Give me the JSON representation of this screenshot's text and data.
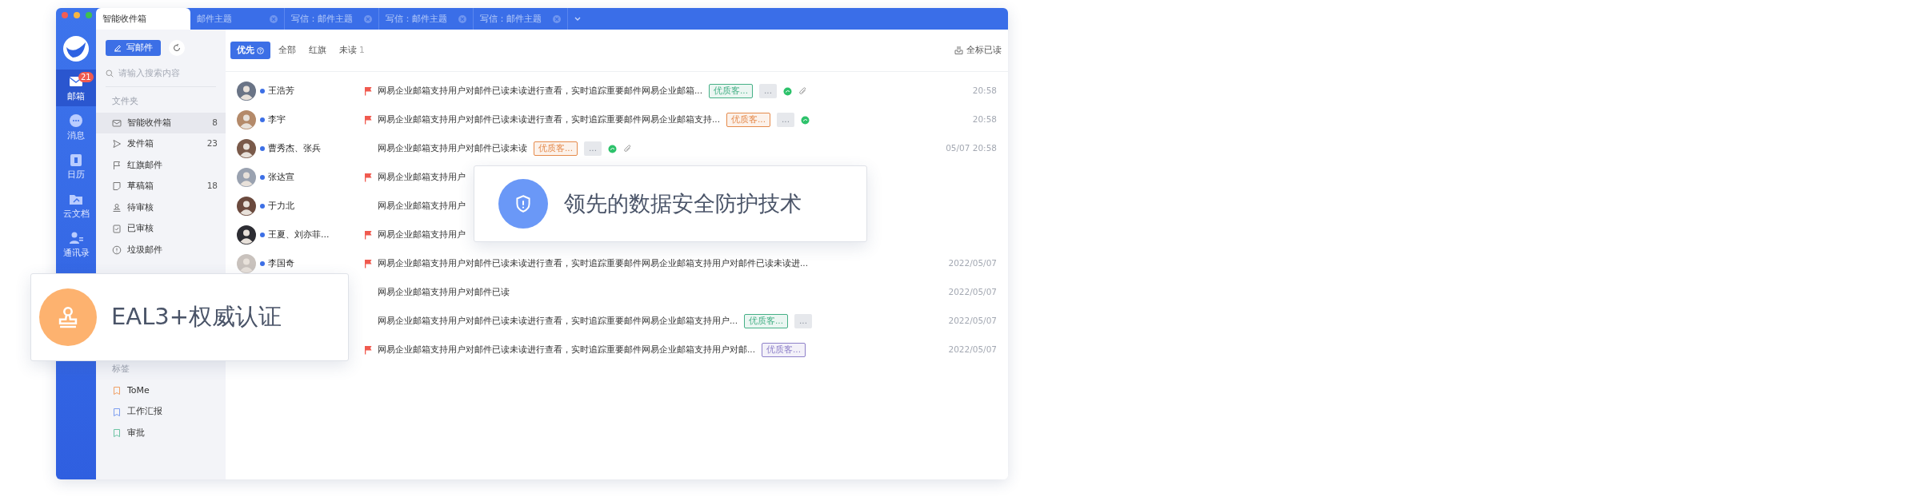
{
  "tabs": [
    {
      "label": "智能收件箱",
      "selected": true,
      "closable": false
    },
    {
      "label": "邮件主题",
      "selected": false,
      "closable": true
    },
    {
      "label": "写信：邮件主题",
      "selected": false,
      "closable": true
    },
    {
      "label": "写信：邮件主题",
      "selected": false,
      "closable": true
    },
    {
      "label": "写信：邮件主题",
      "selected": false,
      "closable": true
    }
  ],
  "rail": [
    {
      "label": "邮箱",
      "selected": true,
      "badge": "21"
    },
    {
      "label": "消息",
      "selected": false
    },
    {
      "label": "日历",
      "selected": false
    },
    {
      "label": "云文档",
      "selected": false
    },
    {
      "label": "通讯录",
      "selected": false
    }
  ],
  "compose_button": "写邮件",
  "search": {
    "placeholder": "请输入搜索内容"
  },
  "folders": {
    "title": "文件夹",
    "items": [
      {
        "label": "智能收件箱",
        "count": "8",
        "selected": true
      },
      {
        "label": "发件箱",
        "count": "23",
        "selected": false
      },
      {
        "label": "红旗邮件",
        "selected": false
      },
      {
        "label": "草稿箱",
        "count": "18",
        "selected": false
      },
      {
        "label": "待审核",
        "selected": false
      },
      {
        "label": "已审核",
        "selected": false
      },
      {
        "label": "垃圾邮件",
        "selected": false
      }
    ]
  },
  "labels": {
    "title": "标签",
    "items": [
      {
        "label": "ToMe",
        "color": "#f0a167"
      },
      {
        "label": "工作汇报",
        "color": "#7d9ef0"
      },
      {
        "label": "审批",
        "color": "#6cc3a4"
      }
    ]
  },
  "filters": [
    {
      "label": "优先",
      "selected": true,
      "help": true
    },
    {
      "label": "全部",
      "selected": false
    },
    {
      "label": "红旗",
      "selected": false
    },
    {
      "label": "未读",
      "selected": false,
      "count": "1"
    }
  ],
  "mark_all_read": "全标已读",
  "messages": [
    {
      "sender": "王浩芳",
      "unread": true,
      "flagged": true,
      "subject": "网易企业邮箱支持用户对邮件已读未读进行查看，实时追踪重要邮件网易企业邮箱...",
      "tags": [
        {
          "kind": "label",
          "text": "优质客...",
          "color": "#45b086"
        },
        {
          "kind": "more",
          "text": "..."
        }
      ],
      "wechat": true,
      "attachment": true,
      "time": "20:58"
    },
    {
      "sender": "李宇",
      "unread": true,
      "flagged": true,
      "subject": "网易企业邮箱支持用户对邮件已读未读进行查看，实时追踪重要邮件网易企业邮箱支持...",
      "tags": [
        {
          "kind": "label",
          "text": "优质客...",
          "color": "#e58a4b"
        },
        {
          "kind": "more",
          "text": "..."
        }
      ],
      "wechat": true,
      "attachment": false,
      "time": "20:58"
    },
    {
      "sender": "曹秀杰、张兵",
      "unread": true,
      "flagged": false,
      "subject": "网易企业邮箱支持用户对邮件已读未读",
      "tags": [
        {
          "kind": "label",
          "text": "优质客...",
          "color": "#e58a4b"
        },
        {
          "kind": "more",
          "text": "..."
        }
      ],
      "wechat": true,
      "attachment": true,
      "time": "05/07 20:58"
    },
    {
      "sender": "张达宣",
      "unread": true,
      "flagged": true,
      "subject": "网易企业邮箱支持用户"
    },
    {
      "sender": "于力北",
      "unread": true,
      "flagged": false,
      "subject": "网易企业邮箱支持用户"
    },
    {
      "sender": "王夏、刘亦菲...",
      "unread": true,
      "flagged": true,
      "subject": "网易企业邮箱支持用户"
    },
    {
      "sender": "李国奇",
      "unread": true,
      "flagged": true,
      "subject": "网易企业邮箱支持用户对邮件已读未读进行查看，实时追踪重要邮件网易企业邮箱支持用户对邮件已读未读进...",
      "time": "2022/05/07"
    },
    {
      "flagged": false,
      "subject": "网易企业邮箱支持用户对邮件已读",
      "time": "2022/05/07"
    },
    {
      "flagged": false,
      "subject": "网易企业邮箱支持用户对邮件已读未读进行查看，实时追踪重要邮件网易企业邮箱支持用户...",
      "tags": [
        {
          "kind": "label",
          "text": "优质客...",
          "color": "#45b086"
        },
        {
          "kind": "more",
          "text": "..."
        }
      ],
      "time": "2022/05/07"
    },
    {
      "flagged": true,
      "subject": "网易企业邮箱支持用户对邮件已读未读进行查看，实时追踪重要邮件网易企业邮箱支持用户对邮...",
      "tags": [
        {
          "kind": "label",
          "text": "优质客...",
          "color": "#8e80c9"
        }
      ],
      "time": "2022/05/07"
    }
  ],
  "highlights": [
    {
      "kind": "security",
      "text": "领先的数据安全防护技术"
    },
    {
      "kind": "certification",
      "text": "EAL3+权威认证"
    }
  ]
}
